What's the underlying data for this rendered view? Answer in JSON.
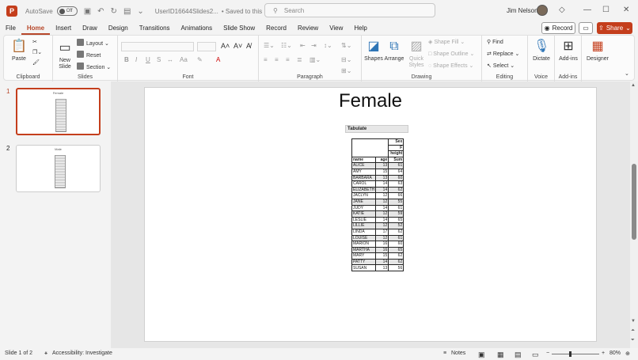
{
  "titlebar": {
    "autosave_label": "AutoSave",
    "autosave_state": "Off",
    "doc_name": "UserID16644Slides2...",
    "saved_status": "• Saved to this PC ⌄",
    "search_placeholder": "Search",
    "user_name": "Jim Nelson"
  },
  "menu": {
    "tabs": [
      "File",
      "Home",
      "Insert",
      "Draw",
      "Design",
      "Transitions",
      "Animations",
      "Slide Show",
      "Record",
      "Review",
      "View",
      "Help"
    ],
    "active_tab": "Home",
    "record_label": "Record",
    "share_label": "Share"
  },
  "ribbon": {
    "clipboard": {
      "label": "Clipboard",
      "paste": "Paste"
    },
    "slides": {
      "label": "Slides",
      "new_slide": "New Slide",
      "layout": "Layout",
      "reset": "Reset",
      "section": "Section"
    },
    "font": {
      "label": "Font"
    },
    "paragraph": {
      "label": "Paragraph"
    },
    "drawing": {
      "label": "Drawing",
      "shapes": "Shapes",
      "arrange": "Arrange",
      "quick_styles": "Quick Styles",
      "shape_fill": "Shape Fill",
      "shape_outline": "Shape Outline",
      "shape_effects": "Shape Effects"
    },
    "editing": {
      "label": "Editing",
      "find": "Find",
      "replace": "Replace",
      "select": "Select"
    },
    "voice": {
      "label": "Voice",
      "dictate": "Dictate"
    },
    "addins": {
      "label": "Add-ins",
      "addins": "Add-ins"
    },
    "designer": {
      "label": "Designer"
    }
  },
  "thumbnails": [
    {
      "number": "1",
      "title": "Female",
      "active": true
    },
    {
      "number": "2",
      "title": "Male",
      "active": false
    }
  ],
  "slide": {
    "title": "Female",
    "tabulate_label": "Tabulate",
    "table": {
      "top_header": [
        "Sex",
        "F",
        "height"
      ],
      "columns": [
        "name",
        "age",
        "Sum"
      ],
      "rows": [
        [
          "ALICE",
          "13",
          "61"
        ],
        [
          "AMY",
          "15",
          "64"
        ],
        [
          "BARBARA",
          "13",
          "60"
        ],
        [
          "CAROL",
          "14",
          "63"
        ],
        [
          "ELIZABETH",
          "14",
          "62"
        ],
        [
          "JACLYN",
          "12",
          "66"
        ],
        [
          "JANE",
          "12",
          "55"
        ],
        [
          "JUDY",
          "14",
          "61"
        ],
        [
          "KATIE",
          "12",
          "59"
        ],
        [
          "LESLIE",
          "14",
          "65"
        ],
        [
          "LILLIE",
          "12",
          "52"
        ],
        [
          "LINDA",
          "17",
          "62"
        ],
        [
          "LOUISE",
          "12",
          "61"
        ],
        [
          "MARION",
          "16",
          "60"
        ],
        [
          "MARTHA",
          "16",
          "65"
        ],
        [
          "MARY",
          "15",
          "62"
        ],
        [
          "PATTY",
          "14",
          "62"
        ],
        [
          "SUSAN",
          "13",
          "56"
        ]
      ]
    }
  },
  "status": {
    "slide_of": "Slide 1 of 2",
    "accessibility": "Accessibility: Investigate",
    "notes": "Notes",
    "zoom": "80%"
  },
  "colors": {
    "accent": "#c43e1c",
    "active_tab": "#b7472a"
  }
}
